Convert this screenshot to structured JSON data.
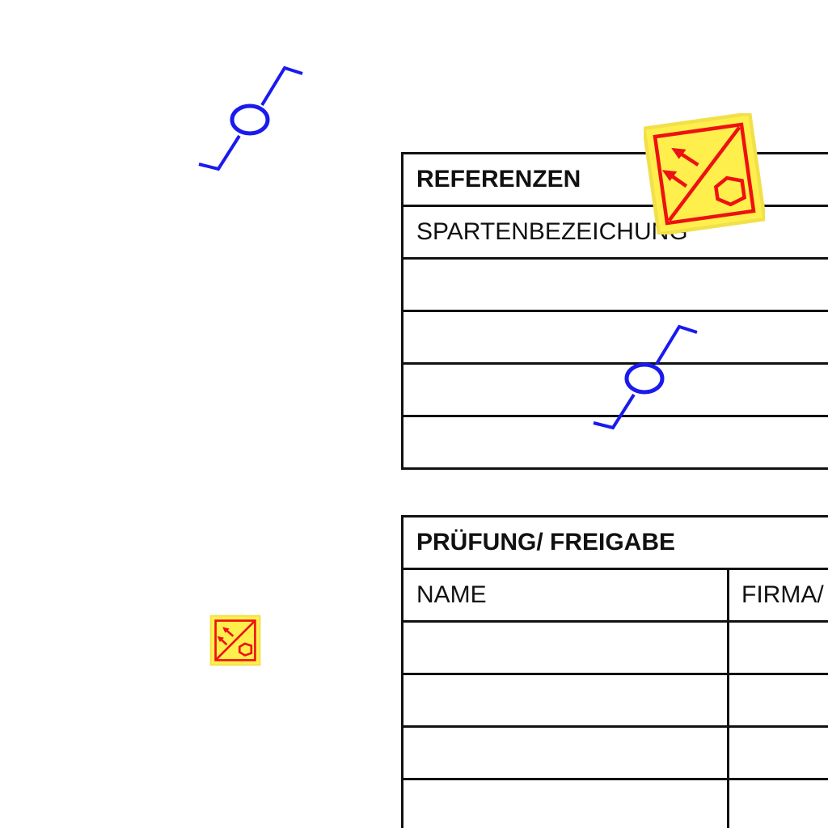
{
  "referenzen": {
    "title": "REFERENZEN",
    "header": "SPARTENBEZEICHUNG",
    "empty_rows": 4
  },
  "pruefung": {
    "title": "PRÜFUNG/ FREIGABE",
    "columns": [
      "NAME",
      "FIRMA/"
    ],
    "empty_rows": 4
  },
  "symbols": {
    "valve_color": "#1a1aee",
    "warning_color": "#ee1111",
    "warning_fill": "#ffef4d",
    "icons": [
      "gate-valve-symbol",
      "warning-sign-symbol"
    ]
  }
}
